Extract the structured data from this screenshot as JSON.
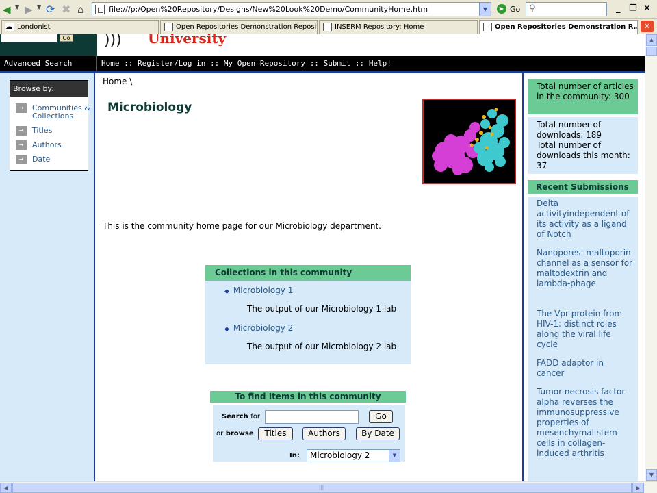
{
  "browser": {
    "address": "file:///p:/Open%20Repository/Designs/New%20Look%20Demo/CommunityHome.htm",
    "go_label": "Go",
    "tabs": [
      "Londonist",
      "Open Repositories Demonstration Reposito...",
      "INSERM Repository: Home",
      "Open Repositories Demonstration R..."
    ],
    "window_controls": [
      "_",
      "❐",
      "✕"
    ]
  },
  "header": {
    "logo_text": "University",
    "search_go": "Go"
  },
  "navbar": {
    "advanced_search": "Advanced Search",
    "links": [
      "Home",
      "Register/Log in",
      "My Open Repository",
      "Submit",
      "Help!"
    ],
    "separator": "::"
  },
  "browse": {
    "title": "Browse by:",
    "items": [
      "Communities & Collections",
      "Titles",
      "Authors",
      "Date"
    ]
  },
  "main": {
    "breadcrumb": "Home \\",
    "title": "Microbiology",
    "intro": "This is the community home page for our Microbiology department.",
    "collections": {
      "header": "Collections in this community",
      "items": [
        {
          "name": "Microbiology 1",
          "desc": "The output of our Microbiology 1 lab"
        },
        {
          "name": "Microbiology 2",
          "desc": "The output of our Microbiology 2 lab"
        }
      ]
    },
    "find": {
      "header": "To find Items in this community",
      "search_label": "Search",
      "search_for": "for",
      "or_label": "or",
      "browse_label": "browse",
      "go_button": "Go",
      "buttons": [
        "Titles",
        "Authors",
        "By Date"
      ],
      "in_label": "In:",
      "in_selected": "Microbiology 2"
    }
  },
  "sidebar": {
    "articles_stat": "Total number of articles in the community: 300",
    "downloads_stat": "Total number of downloads: 189",
    "downloads_month_stat": "Total number of downloads this month: 37",
    "recent_header": "Recent Submissions",
    "recent": [
      "Delta activityindependent of its activity as a ligand of Notch",
      "Nanopores: maltoporin channel as a sensor for maltodextrin and lambda-phage",
      "The Vpr protein from HIV-1: distinct roles along the viral life cycle",
      "FADD adaptor in cancer",
      "Tumor necrosis factor alpha reverses the immunosuppressive properties of mesenchymal stem cells in collagen-induced arthritis"
    ]
  }
}
